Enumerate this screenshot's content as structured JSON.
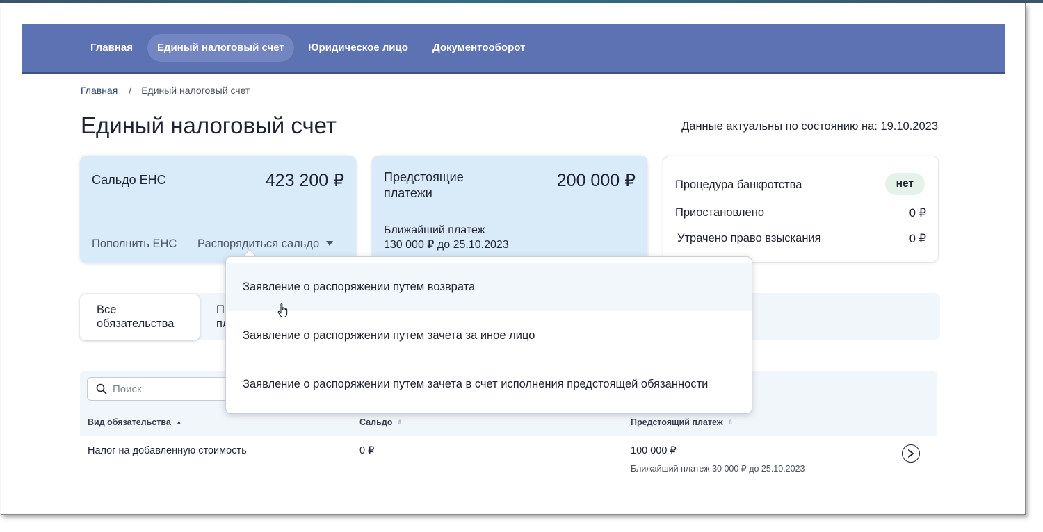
{
  "nav": {
    "items": [
      {
        "label": "Главная"
      },
      {
        "label": "Единый налоговый счет"
      },
      {
        "label": "Юридическое лицо"
      },
      {
        "label": "Документооборот"
      }
    ]
  },
  "breadcrumb": {
    "home": "Главная",
    "separator": "/",
    "current": "Единый налоговый счет"
  },
  "page": {
    "title": "Единый налоговый счет",
    "actual_date": "Данные актуальны по состоянию на: 19.10.2023"
  },
  "cards": {
    "balance": {
      "label": "Сальдо ЕНС",
      "amount": "423 200 ₽",
      "topup_link": "Пополнить ЕНС",
      "dispose_link": "Распорядиться сальдо"
    },
    "upcoming": {
      "label_line1": "Предстоящие",
      "label_line2": "платежи",
      "amount": "200 000 ₽",
      "nearest_label": "Ближайший платеж",
      "nearest_value": "130 000 ₽ до 25.10.2023"
    },
    "status": {
      "bankruptcy_label": "Процедура банкротства",
      "bankruptcy_value": "нет",
      "suspended_label": "Приостановлено",
      "suspended_value": "0 ₽",
      "lost_label": "Утрачено право взыскания",
      "lost_value": "0 ₽"
    }
  },
  "tabs": {
    "all_line1": "Все",
    "all_line2": "обязательства",
    "second_line1": "П",
    "second_line2": "пл"
  },
  "search": {
    "placeholder": "Поиск"
  },
  "table": {
    "headers": {
      "type": "Вид обязательства",
      "balance": "Сальдо",
      "upcoming": "Предстоящий платеж"
    },
    "rows": [
      {
        "type": "Налог на добавленную стоимость",
        "balance": "0 ₽",
        "upcoming": "100 000 ₽",
        "upcoming_sub": "Ближайший платеж 30 000 ₽ до 25.10.2023"
      }
    ]
  },
  "dropdown": {
    "items": [
      {
        "label": "Заявление о распоряжении путем возврата"
      },
      {
        "label": "Заявление о распоряжении путем зачета за иное лицо"
      },
      {
        "label": "Заявление о распоряжении путем зачета в счет исполнения предстоящей обязанности"
      }
    ]
  },
  "colors": {
    "nav_bg": "#5d72b3",
    "nav_active": "#7386c2",
    "card_blue": "#d9ebf8",
    "badge_bg": "#e4f2ea",
    "table_header_bg": "#f1f6fa"
  }
}
